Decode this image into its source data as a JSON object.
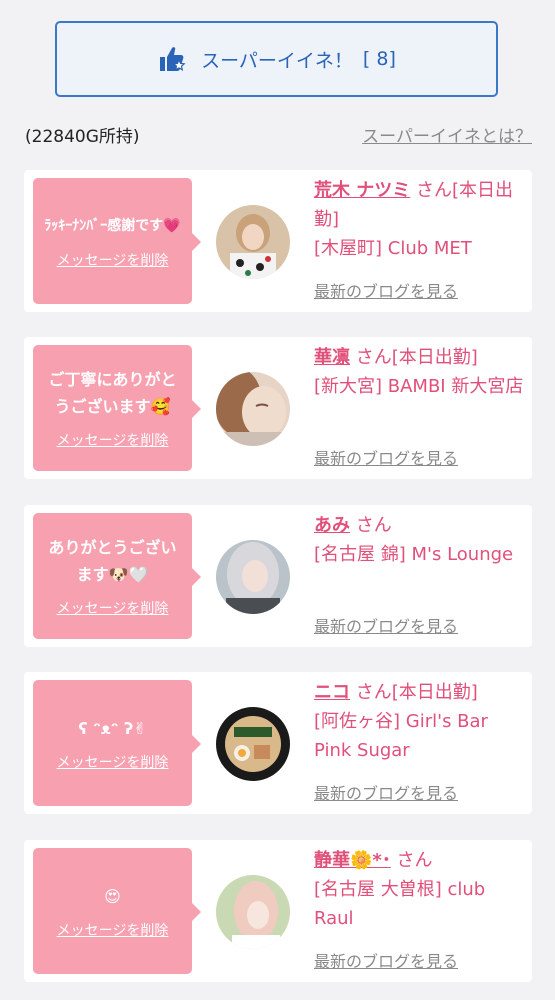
{
  "super_like": {
    "label": "スーパーイイネ！",
    "count": "[ 8]"
  },
  "balance": "(22840G所持)",
  "about_link": "スーパーイイネとは？",
  "cards": [
    {
      "message": "ﾗｯｷｰﾅﾝﾊﾞｰ感謝です💗",
      "delete_label": "メッセージを削除",
      "name": "荒木 ナツミ",
      "suffix": " さん[本日出勤]",
      "shop": "[木屋町] Club MET",
      "blog_label": "最新のブログを見る"
    },
    {
      "message": "ご丁寧にありがとうございます🥰",
      "delete_label": "メッセージを削除",
      "name": "華凛",
      "suffix": " さん[本日出勤]",
      "shop": "[新大宮] BAMBI 新大宮店",
      "blog_label": "最新のブログを見る"
    },
    {
      "message": "ありがとうございます🐶🤍",
      "delete_label": "メッセージを削除",
      "name": "あみ",
      "suffix": " さん",
      "shop": "[名古屋 錦] M's Lounge",
      "blog_label": "最新のブログを見る"
    },
    {
      "message": "ʕ ᵔᴥᵔ ʔ✌",
      "delete_label": "メッセージを削除",
      "name": "ニコ",
      "suffix": " さん[本日出勤]",
      "shop": "[阿佐ヶ谷] Girl's Bar Pink Sugar",
      "blog_label": "最新のブログを見る"
    },
    {
      "message": "😍",
      "delete_label": "メッセージを削除",
      "name": "静華🌼*･",
      "suffix": " さん",
      "shop": "[名古屋 大曽根] club Raul",
      "blog_label": "最新のブログを見る"
    }
  ],
  "colors": {
    "accent_blue": "#2a64b8",
    "pink": "#f7a0b0",
    "name_pink": "#e0507a",
    "gray": "#8a8a8a"
  }
}
